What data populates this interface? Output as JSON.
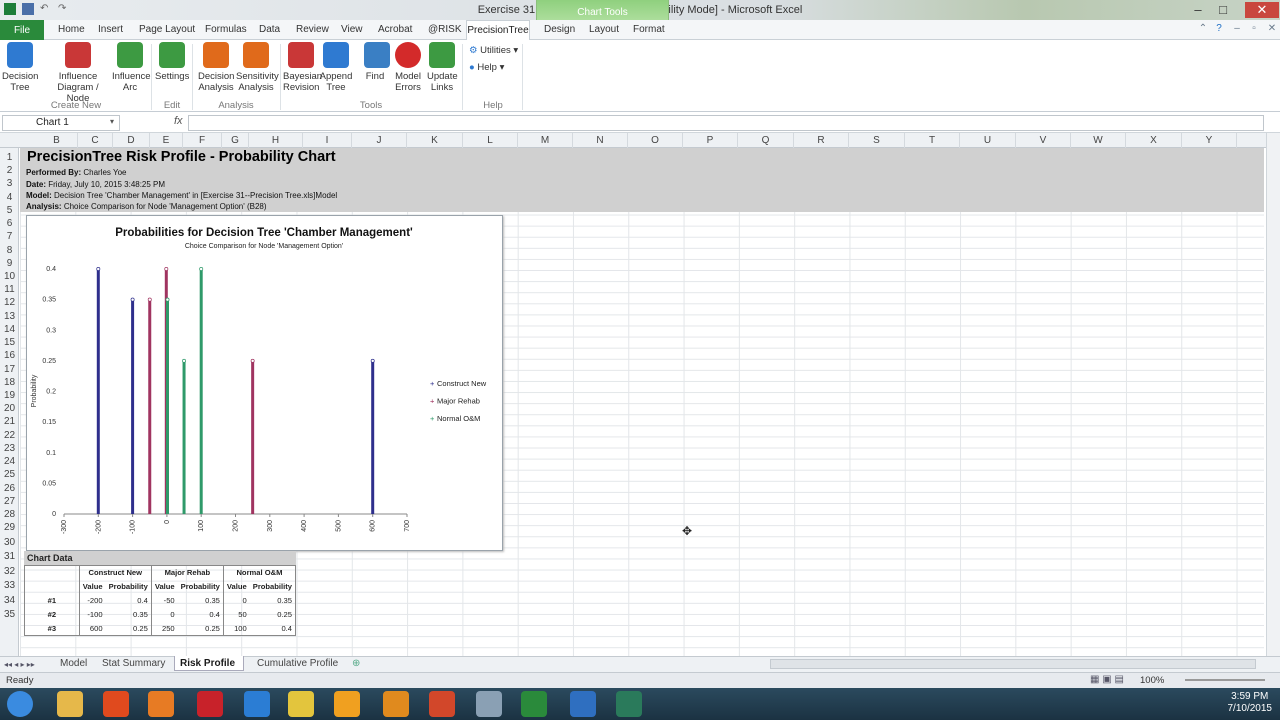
{
  "window": {
    "title": "Exercise 31 - Precision Tree  [Compatibility Mode]  -  Microsoft Excel",
    "context_tab_group": "Chart Tools"
  },
  "tabs": {
    "file": "File",
    "items": [
      "Home",
      "Insert",
      "Page Layout",
      "Formulas",
      "Data",
      "Review",
      "View",
      "Acrobat",
      "@RISK",
      "PrecisionTree"
    ],
    "context": [
      "Design",
      "Layout",
      "Format"
    ]
  },
  "ribbon": {
    "buttons": [
      {
        "label1": "Decision",
        "label2": "Tree",
        "color": "#2f7ad1"
      },
      {
        "label1": "Influence",
        "label2": "Diagram / Node",
        "color": "#c93737"
      },
      {
        "label1": "Influence",
        "label2": "Arc",
        "color": "#3d9a42"
      },
      {
        "label1": "Settings",
        "label2": "",
        "color": "#3d9a42"
      },
      {
        "label1": "Decision",
        "label2": "Analysis",
        "color": "#e06a1b"
      },
      {
        "label1": "Sensitivity",
        "label2": "Analysis",
        "color": "#e06a1b"
      },
      {
        "label1": "Bayesian",
        "label2": "Revision",
        "color": "#c93737"
      },
      {
        "label1": "Append",
        "label2": "Tree",
        "color": "#2f7ad1"
      },
      {
        "label1": "Find",
        "label2": "",
        "color": "#3a7fc4"
      },
      {
        "label1": "Model",
        "label2": "Errors",
        "color": "#d32a2a"
      },
      {
        "label1": "Update",
        "label2": "Links",
        "color": "#3d9a42"
      }
    ],
    "small": {
      "utilities": "Utilities",
      "help": "Help"
    },
    "groups": [
      "Create New",
      "Edit",
      "Analysis",
      "Tools",
      "Help"
    ]
  },
  "formula": {
    "namebox": "Chart 1",
    "fx": "fx",
    "value": ""
  },
  "columns": [
    "B",
    "C",
    "D",
    "E",
    "F",
    "G",
    "H",
    "I",
    "J",
    "K",
    "L",
    "M",
    "N",
    "O",
    "P",
    "Q",
    "R",
    "S",
    "T",
    "U",
    "V",
    "W",
    "X",
    "Y"
  ],
  "rows": [
    "1",
    "2",
    "3",
    "4",
    "5",
    "6",
    "7",
    "8",
    "9",
    "10",
    "11",
    "12",
    "13",
    "14",
    "15",
    "16",
    "17",
    "18",
    "19",
    "20",
    "21",
    "22",
    "23",
    "24",
    "25",
    "26",
    "27",
    "28",
    "29",
    "30",
    "31",
    "32",
    "33",
    "34",
    "35"
  ],
  "sheet": {
    "title": "PrecisionTree Risk Profile - Probability Chart",
    "performed_label": "Performed By:",
    "performed_value": "Charles Yoe",
    "date_label": "Date:",
    "date_value": "Friday, July 10, 2015 3:48:25 PM",
    "model_label": "Model:",
    "model_value": "Decision Tree 'Chamber Management' in [Exercise 31--Precision Tree.xls]Model",
    "analysis_label": "Analysis:",
    "analysis_value": "Choice Comparison for Node 'Management Option' (B28)"
  },
  "chart_data": {
    "type": "bar",
    "title": "Probabilities for Decision Tree 'Chamber Management'",
    "subtitle": "Choice Comparison for Node 'Management Option'",
    "xlabel": "",
    "ylabel": "Probability",
    "xlim": [
      -300,
      700
    ],
    "ylim": [
      0,
      0.4
    ],
    "xticks": [
      "-300",
      "-200",
      "-100",
      "0",
      "100",
      "200",
      "300",
      "400",
      "500",
      "600",
      "700"
    ],
    "yticks": [
      "0",
      "0.05",
      "0.1",
      "0.15",
      "0.2",
      "0.25",
      "0.3",
      "0.35",
      "0.4"
    ],
    "legend_position": "right",
    "series": [
      {
        "name": "Construct New",
        "color": "#2e2f8c",
        "x": [
          -200,
          -100,
          600
        ],
        "y": [
          0.4,
          0.35,
          0.25
        ]
      },
      {
        "name": "Major Rehab",
        "color": "#a03460",
        "x": [
          -50,
          0,
          250
        ],
        "y": [
          0.35,
          0.4,
          0.25
        ]
      },
      {
        "name": "Normal O&M",
        "color": "#2f9a6a",
        "x": [
          0,
          50,
          100
        ],
        "y": [
          0.35,
          0.25,
          0.4
        ]
      }
    ]
  },
  "table": {
    "title": "Chart Data",
    "groups": [
      "Construct New",
      "Major Rehab",
      "Normal O&M"
    ],
    "sub": [
      "Value",
      "Probability",
      "Value",
      "Probability",
      "Value",
      "Probability"
    ],
    "rows": [
      {
        "label": "#1",
        "cells": [
          "-200",
          "0.4",
          "-50",
          "0.35",
          "0",
          "0.35"
        ]
      },
      {
        "label": "#2",
        "cells": [
          "-100",
          "0.35",
          "0",
          "0.4",
          "50",
          "0.25"
        ]
      },
      {
        "label": "#3",
        "cells": [
          "600",
          "0.25",
          "250",
          "0.25",
          "100",
          "0.4"
        ]
      }
    ]
  },
  "sheettabs": [
    "Model",
    "Stat Summary",
    "Risk Profile",
    "Cumulative Profile"
  ],
  "status": {
    "ready": "Ready",
    "zoom": "100%"
  },
  "clock": {
    "time": "3:59 PM",
    "date": "7/10/2015"
  }
}
